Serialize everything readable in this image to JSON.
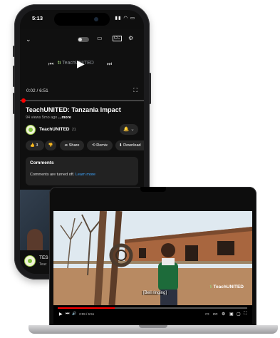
{
  "phone": {
    "status": {
      "time": "5:13",
      "icons": "▮▮ ◠ ▭"
    },
    "player": {
      "collapse_icon": "⌄",
      "cast_icon": "▭",
      "captions_icon": "CC",
      "settings_icon": "⚙",
      "prev_icon": "⏮",
      "play_icon": "▶",
      "next_icon": "⏭",
      "brand_mark": "ti",
      "brand_text": "TeachUNITED",
      "time": "0:02 / 6:51",
      "fullscreen_icon": "⛶",
      "progress": 0.005
    },
    "video": {
      "title": "TeachUNITED: Tanzania Impact",
      "meta": "94 views  5mo ago",
      "more": "...more"
    },
    "channel": {
      "name": "TeachUNITED",
      "subs": "21",
      "bell_icon": "🔔 ⌄"
    },
    "actions": [
      {
        "label": "👍  3",
        "name": "like-button"
      },
      {
        "label": "👎",
        "name": "dislike-button"
      },
      {
        "label": "➦ Share",
        "name": "share-button"
      },
      {
        "label": "⟲ Remix",
        "name": "remix-button"
      },
      {
        "label": "⬇ Download",
        "name": "download-button"
      }
    ],
    "comments": {
      "title": "Comments",
      "text": "Comments are turned off.",
      "link": "Learn more"
    },
    "bottom": {
      "title": "TES",
      "sub": "Teac"
    }
  },
  "laptop": {
    "subtitle": "[Bell ringing]",
    "watermark_mark": "ti",
    "watermark_text": "TeachUNITED",
    "progress": 0.3,
    "time": "2:09 / 6:51",
    "controls_left": [
      "▶",
      "⏭",
      "🔊"
    ],
    "controls_right": [
      "▭",
      "CC",
      "⚙",
      "▣",
      "▢",
      "⛶"
    ]
  },
  "colors": {
    "accent_green": "#7fbf3b",
    "youtube_red": "#ff0000",
    "link_blue": "#3ea6ff"
  }
}
